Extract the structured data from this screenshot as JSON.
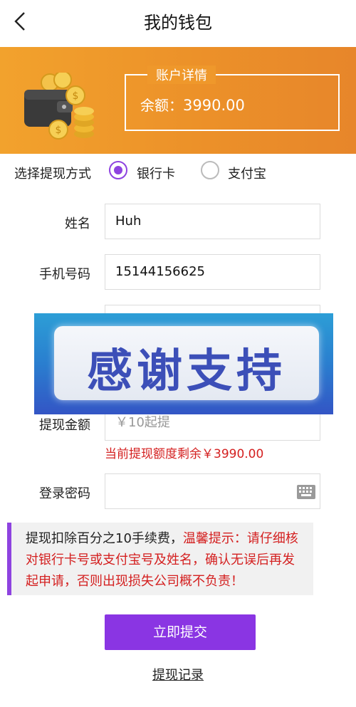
{
  "header": {
    "title": "我的钱包",
    "back_icon": "chevron-left-icon"
  },
  "banner": {
    "account_title": "账户详情",
    "balance_label": "余额：",
    "balance_value": "3990.00",
    "colors": {
      "banner": "#ec9129"
    }
  },
  "withdraw_method": {
    "label": "选择提现方式",
    "options": [
      {
        "label": "银行卡",
        "selected": true
      },
      {
        "label": "支付宝",
        "selected": false
      }
    ]
  },
  "form": {
    "name": {
      "label": "姓名",
      "value": "Huh"
    },
    "phone": {
      "label": "手机号码",
      "value": "15144156625"
    },
    "amount": {
      "label": "提现金额",
      "placeholder": "￥10起提"
    },
    "quota_hint": "当前提现额度剩余￥3990.00",
    "password": {
      "label": "登录密码",
      "value": ""
    }
  },
  "overlay": {
    "text": "感谢支持"
  },
  "notice": {
    "fee_text": "提现扣除百分之10手续费，",
    "warning_text": "温馨提示：请仔细核对银行卡号或支付宝号及姓名，确认无误后再发起申请，否则出现损失公司概不负责！"
  },
  "actions": {
    "submit_label": "立即提交",
    "record_link": "提现记录"
  },
  "colors": {
    "accent": "#8a35e3",
    "warning": "#d42020"
  }
}
